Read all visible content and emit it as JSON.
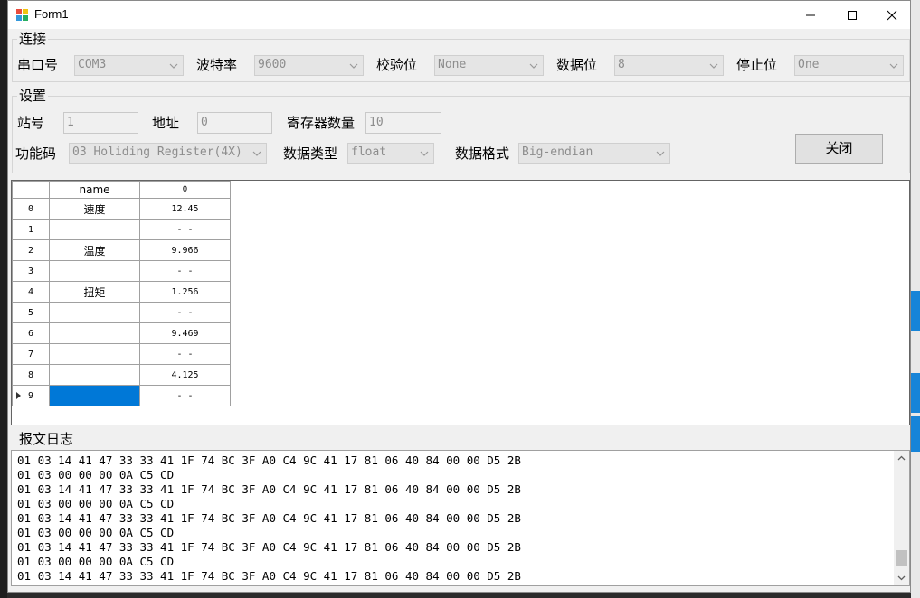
{
  "window": {
    "title": "Form1"
  },
  "connection": {
    "group_label": "连接",
    "port_label": "串口号",
    "port_value": "COM3",
    "baud_label": "波特率",
    "baud_value": "9600",
    "parity_label": "校验位",
    "parity_value": "None",
    "databits_label": "数据位",
    "databits_value": "8",
    "stopbits_label": "停止位",
    "stopbits_value": "One"
  },
  "settings": {
    "group_label": "设置",
    "station_label": "站号",
    "station_value": "1",
    "address_label": "地址",
    "address_value": "0",
    "regcount_label": "寄存器数量",
    "regcount_value": "10",
    "function_label": "功能码",
    "function_value": "03 Holiding Register(4X)",
    "datatype_label": "数据类型",
    "datatype_value": "float",
    "dataformat_label": "数据格式",
    "dataformat_value": "Big-endian",
    "close_button": "关闭"
  },
  "grid": {
    "headers": [
      "name",
      "0"
    ],
    "rows": [
      {
        "index": "0",
        "name": "速度",
        "value": "12.45"
      },
      {
        "index": "1",
        "name": "",
        "value": "- -"
      },
      {
        "index": "2",
        "name": "温度",
        "value": "9.966"
      },
      {
        "index": "3",
        "name": "",
        "value": "- -"
      },
      {
        "index": "4",
        "name": "扭矩",
        "value": "1.256"
      },
      {
        "index": "5",
        "name": "",
        "value": "- -"
      },
      {
        "index": "6",
        "name": "",
        "value": "9.469"
      },
      {
        "index": "7",
        "name": "",
        "value": "- -"
      },
      {
        "index": "8",
        "name": "",
        "value": "4.125"
      },
      {
        "index": "9",
        "name": "",
        "value": "- -"
      }
    ]
  },
  "log": {
    "group_label": "报文日志",
    "lines": [
      "01 03 14 41 47 33 33 41 1F 74 BC 3F A0 C4 9C 41 17 81 06 40 84 00 00 D5 2B",
      "01 03 00 00 00 0A C5 CD",
      "01 03 14 41 47 33 33 41 1F 74 BC 3F A0 C4 9C 41 17 81 06 40 84 00 00 D5 2B",
      "01 03 00 00 00 0A C5 CD",
      "01 03 14 41 47 33 33 41 1F 74 BC 3F A0 C4 9C 41 17 81 06 40 84 00 00 D5 2B",
      "01 03 00 00 00 0A C5 CD",
      "01 03 14 41 47 33 33 41 1F 74 BC 3F A0 C4 9C 41 17 81 06 40 84 00 00 D5 2B",
      "01 03 00 00 00 0A C5 CD",
      "01 03 14 41 47 33 33 41 1F 74 BC 3F A0 C4 9C 41 17 81 06 40 84 00 00 D5 2B"
    ]
  },
  "icons": {
    "app": "form-app-icon",
    "minimize": "minimize-icon",
    "maximize": "maximize-icon",
    "close": "close-icon",
    "dropdown": "chevron-down-icon",
    "row_pointer": "row-pointer-icon"
  },
  "colors": {
    "selection": "#0078d7",
    "window_bg": "#f0f0f0",
    "disabled_text": "#8d8d8d"
  }
}
